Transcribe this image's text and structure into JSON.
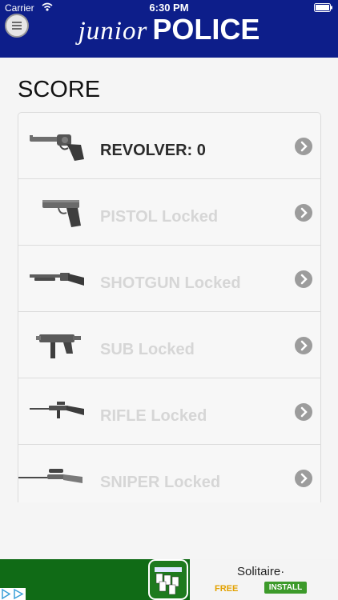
{
  "status_bar": {
    "carrier": "Carrier",
    "time": "6:30 PM"
  },
  "header": {
    "brand_junior": "junior",
    "brand_police": "POLICE"
  },
  "page": {
    "title": "SCORE"
  },
  "weapons": [
    {
      "label": "REVOLVER: 0",
      "icon": "revolver-icon",
      "unlocked": true
    },
    {
      "label": "PISTOL Locked",
      "icon": "pistol-icon",
      "unlocked": false
    },
    {
      "label": "SHOTGUN Locked",
      "icon": "shotgun-icon",
      "unlocked": false
    },
    {
      "label": "SUB Locked",
      "icon": "submachine-gun-icon",
      "unlocked": false
    },
    {
      "label": "RIFLE Locked",
      "icon": "rifle-icon",
      "unlocked": false
    },
    {
      "label": "SNIPER Locked",
      "icon": "sniper-rifle-icon",
      "unlocked": false
    }
  ],
  "ad": {
    "title": "Solitaire·",
    "free": "FREE",
    "install": "INSTALL"
  },
  "colors": {
    "header": "#0d1e8a",
    "locked_text": "#d6d6d6",
    "unlocked_text": "#2b2b2b",
    "ad_green": "#106b16"
  }
}
